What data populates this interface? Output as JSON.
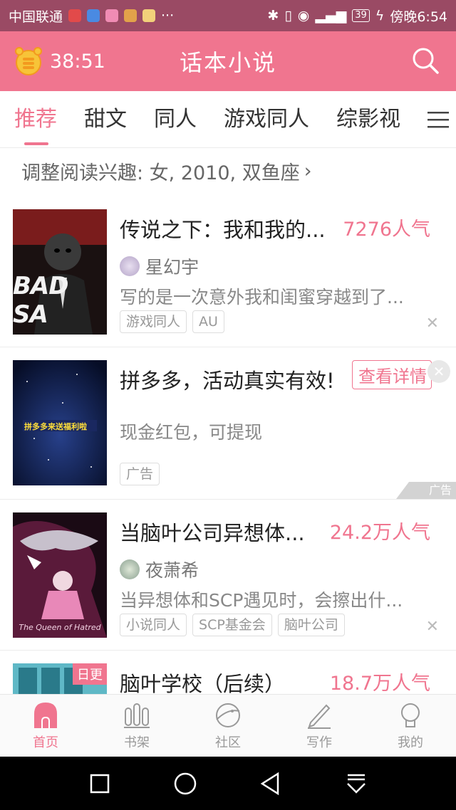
{
  "status": {
    "carrier": "中国联通",
    "time": "傍晚6:54",
    "battery": "39",
    "colors": {
      "bar": "#9a4a64"
    }
  },
  "header": {
    "timer": "38:51",
    "title": "话本小说",
    "accent": "#f0758f"
  },
  "tabs": [
    {
      "label": "推荐"
    },
    {
      "label": "甜文"
    },
    {
      "label": "同人"
    },
    {
      "label": "游戏同人"
    },
    {
      "label": "综影视"
    }
  ],
  "interest": {
    "label": "调整阅读兴趣: 女, 2010, 双鱼座"
  },
  "feed": {
    "items": [
      {
        "title": "传说之下：我和我的...",
        "heat": "7276人气",
        "author": "星幻宇",
        "desc": "写的是一次意外我和闺蜜穿越到了...",
        "tags": [
          "游戏同人",
          "AU"
        ],
        "cover_text": "BAD SA"
      },
      {
        "title": "拼多多，活动真实有效!",
        "button": "查看详情",
        "desc": "现金红包，可提现",
        "tag": "广告",
        "ad_mark": "广告",
        "cover_text": "拼多多来送福利啦"
      },
      {
        "title": "当脑叶公司异想体...",
        "heat": "24.2万人气",
        "author": "夜萧希",
        "desc": "当异想体和SCP遇见时，会擦出什...",
        "tags": [
          "小说同人",
          "SCP基金会",
          "脑叶公司"
        ],
        "cover_text": "The Queen of Hatred"
      },
      {
        "title": "脑叶学校（后续）",
        "heat": "18.7万人气",
        "badge": "日更"
      }
    ]
  },
  "bottom_nav": [
    {
      "label": "首页",
      "icon": "home-icon"
    },
    {
      "label": "书架",
      "icon": "bookshelf-icon"
    },
    {
      "label": "社区",
      "icon": "community-icon"
    },
    {
      "label": "写作",
      "icon": "write-icon"
    },
    {
      "label": "我的",
      "icon": "profile-icon"
    }
  ]
}
